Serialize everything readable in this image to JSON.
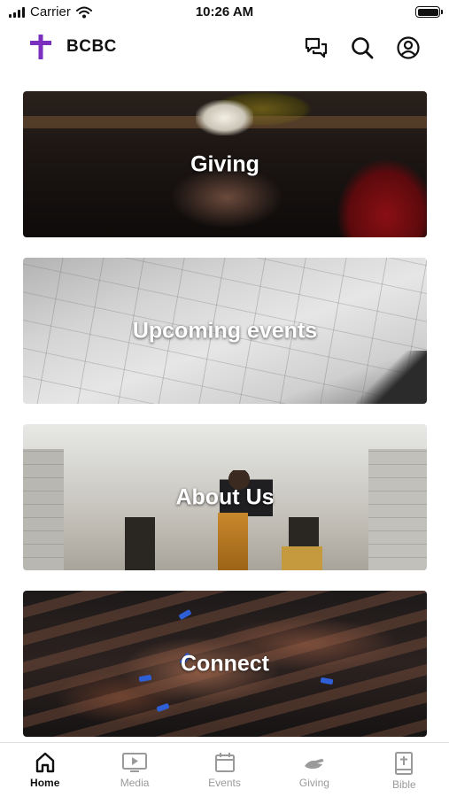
{
  "status_bar": {
    "carrier": "Carrier",
    "time": "10:26 AM"
  },
  "app_bar": {
    "title": "BCBC",
    "logo_icon": "cross-icon",
    "logo_color": "#7B2FBF",
    "actions": [
      "chat-icon",
      "search-icon",
      "account-icon"
    ]
  },
  "cards": [
    {
      "label": "Giving"
    },
    {
      "label": "Upcoming events"
    },
    {
      "label": "About Us"
    },
    {
      "label": "Connect"
    }
  ],
  "tabs": [
    {
      "label": "Home",
      "icon": "home-icon",
      "active": true
    },
    {
      "label": "Media",
      "icon": "media-icon",
      "active": false
    },
    {
      "label": "Events",
      "icon": "calendar-icon",
      "active": false
    },
    {
      "label": "Giving",
      "icon": "giving-icon",
      "active": false
    },
    {
      "label": "Bible",
      "icon": "bible-icon",
      "active": false
    }
  ],
  "colors": {
    "accent": "#7B2FBF",
    "tab_active": "#111111",
    "tab_inactive": "#9A9A9A"
  }
}
